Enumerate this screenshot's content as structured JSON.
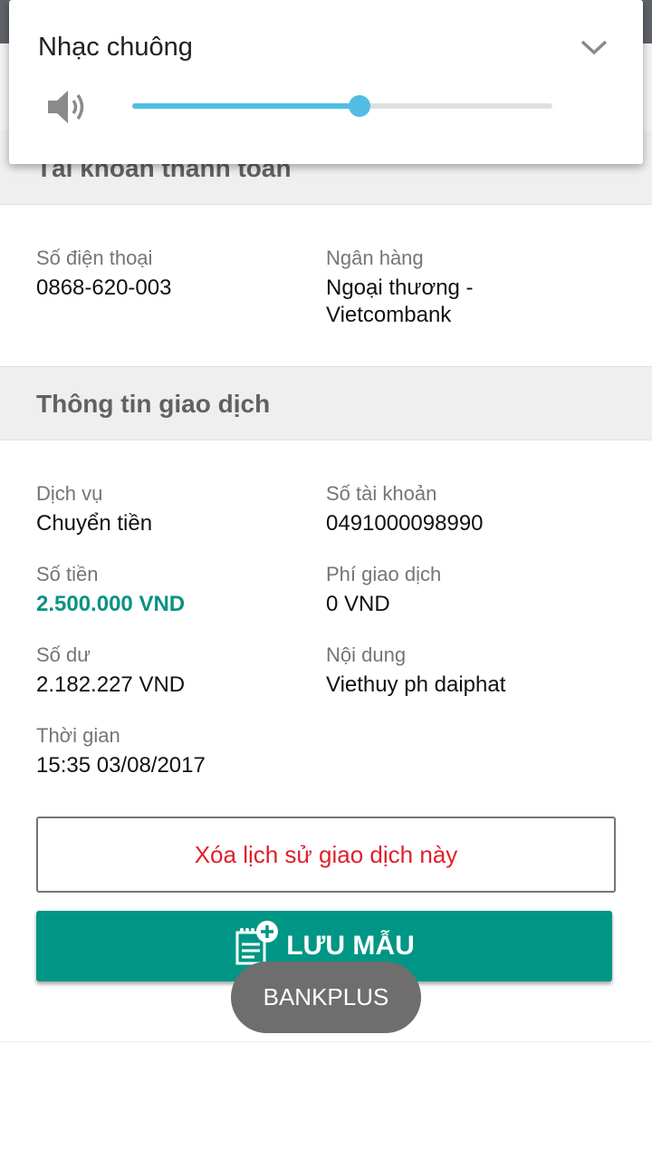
{
  "volume_panel": {
    "title": "Nhạc chuông",
    "level": 0.54,
    "speaker_icon": "speaker-icon",
    "expand_icon": "chevron-down-icon",
    "accent_color": "#52bde3"
  },
  "account_section": {
    "title": "Tài khoản thanh toán",
    "phone_label": "Số điện thoại",
    "phone_value": "0868-620-003",
    "bank_label": "Ngân hàng",
    "bank_value": "Ngoại thương -\nVietcombank"
  },
  "transaction_section": {
    "title": "Thông tin giao dịch",
    "service_label": "Dịch vụ",
    "service_value": "Chuyển tiền",
    "account_no_label": "Số tài khoản",
    "account_no_value": "0491000098990",
    "amount_label": "Số tiền",
    "amount_value": "2.500.000 VND",
    "fee_label": "Phí giao dịch",
    "fee_value": "0 VND",
    "balance_label": "Số dư",
    "balance_value": "2.182.227 VND",
    "content_label": "Nội dung",
    "content_value": "Viethuy ph daiphat",
    "time_label": "Thời gian",
    "time_value": "15:35 03/08/2017"
  },
  "actions": {
    "delete_label": "Xóa lịch sử giao dịch này",
    "save_label": "LƯU MẪU",
    "save_icon": "add-template-icon"
  },
  "toast": {
    "text": "BANKPLUS"
  },
  "colors": {
    "primary": "#009685",
    "amount": "#0b9283",
    "danger": "#e0202a"
  }
}
